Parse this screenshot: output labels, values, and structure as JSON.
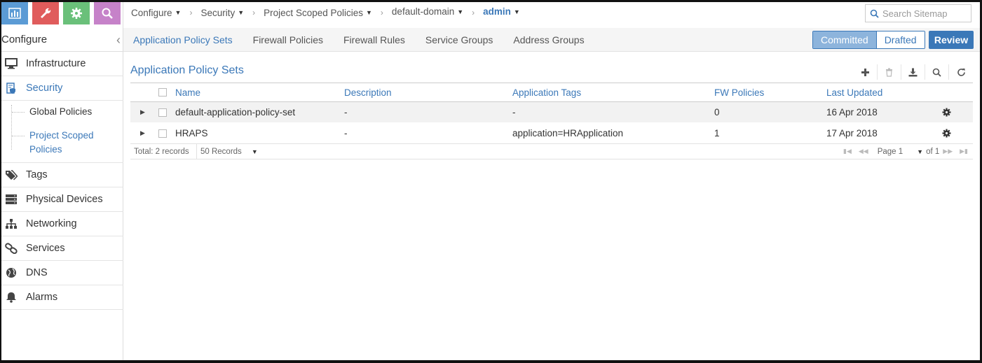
{
  "quick_tabs": [
    {
      "icon": "bar-chart-icon",
      "color": "#5b9bd5"
    },
    {
      "icon": "wrench-icon",
      "color": "#e05c5c"
    },
    {
      "icon": "gear-icon",
      "color": "#6ac07a"
    },
    {
      "icon": "search-icon",
      "color": "#c682c9"
    }
  ],
  "sidebar": {
    "title": "Configure",
    "items": [
      {
        "label": "Infrastructure",
        "icon": "monitor-icon"
      },
      {
        "label": "Security",
        "icon": "shield-doc-icon"
      },
      {
        "label": "Tags",
        "icon": "tags-icon"
      },
      {
        "label": "Physical Devices",
        "icon": "server-icon"
      },
      {
        "label": "Networking",
        "icon": "sitemap-icon"
      },
      {
        "label": "Services",
        "icon": "link-icon"
      },
      {
        "label": "DNS",
        "icon": "globe-icon"
      },
      {
        "label": "Alarms",
        "icon": "bell-icon"
      }
    ],
    "security_sub": {
      "global": "Global Policies",
      "project_line1": "Project Scoped",
      "project_line2": "Policies"
    }
  },
  "breadcrumb": {
    "items": [
      "Configure",
      "Security",
      "Project Scoped Policies",
      "default-domain",
      "admin"
    ]
  },
  "search": {
    "placeholder": "Search Sitemap"
  },
  "tabs": [
    "Application Policy Sets",
    "Firewall Policies",
    "Firewall Rules",
    "Service Groups",
    "Address Groups"
  ],
  "mode": {
    "committed": "Committed",
    "drafted": "Drafted",
    "review": "Review"
  },
  "grid": {
    "title": "Application Policy Sets",
    "columns": [
      "Name",
      "Description",
      "Application Tags",
      "FW Policies",
      "Last Updated"
    ],
    "rows": [
      {
        "name": "default-application-policy-set",
        "description": "-",
        "tags": "-",
        "fw": "0",
        "updated": "16 Apr 2018"
      },
      {
        "name": "HRAPS",
        "description": "-",
        "tags": "application=HRApplication",
        "fw": "1",
        "updated": "17 Apr 2018"
      }
    ],
    "footer": {
      "total": "Total: 2 records",
      "per_page": "50 Records",
      "page": "Page 1",
      "of": "of 1"
    }
  },
  "colors": {
    "accent": "#3b78b8"
  }
}
